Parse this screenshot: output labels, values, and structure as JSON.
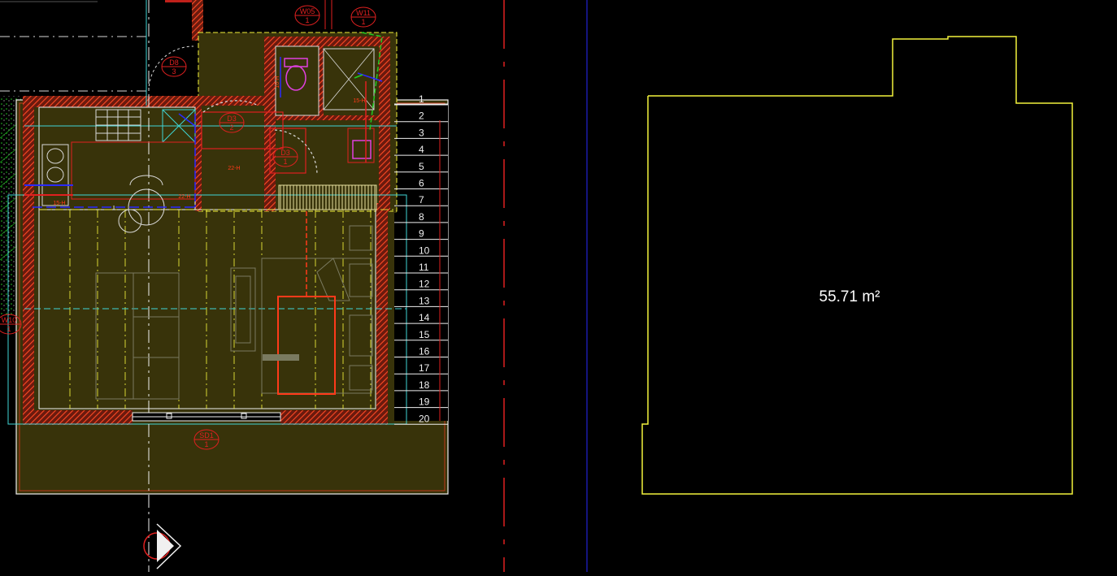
{
  "plan": {
    "tags": [
      {
        "code": "W05",
        "num": "1"
      },
      {
        "code": "W11",
        "num": "1"
      },
      {
        "code": "D8",
        "num": "3"
      },
      {
        "code": "D3",
        "num": "2"
      },
      {
        "code": "D3",
        "num": "1"
      },
      {
        "code": "W10",
        "num": "1"
      },
      {
        "code": "SD1",
        "num": "1"
      }
    ],
    "small_labels": [
      "15-H",
      "22-H",
      "22-H",
      "16-H",
      "15-H"
    ],
    "stair_steps": [
      "1",
      "2",
      "3",
      "4",
      "5",
      "6",
      "7",
      "8",
      "9",
      "10",
      "11",
      "12",
      "13",
      "14",
      "15",
      "16",
      "17",
      "18",
      "19",
      "20"
    ]
  },
  "area": {
    "value": "55.71 m²"
  },
  "colors": {
    "background": "#000000",
    "floor_fill": "#38330a",
    "wall_hatch": "#e03a1e",
    "outline_white": "#f0f0f0",
    "cyan": "#3fd6d6",
    "red": "#ff1a1a",
    "blue": "#2a2aff",
    "yellow": "#f2f23c",
    "green": "#22cc22",
    "magenta": "#e040e0",
    "divider_blue": "#1a1aa8"
  }
}
